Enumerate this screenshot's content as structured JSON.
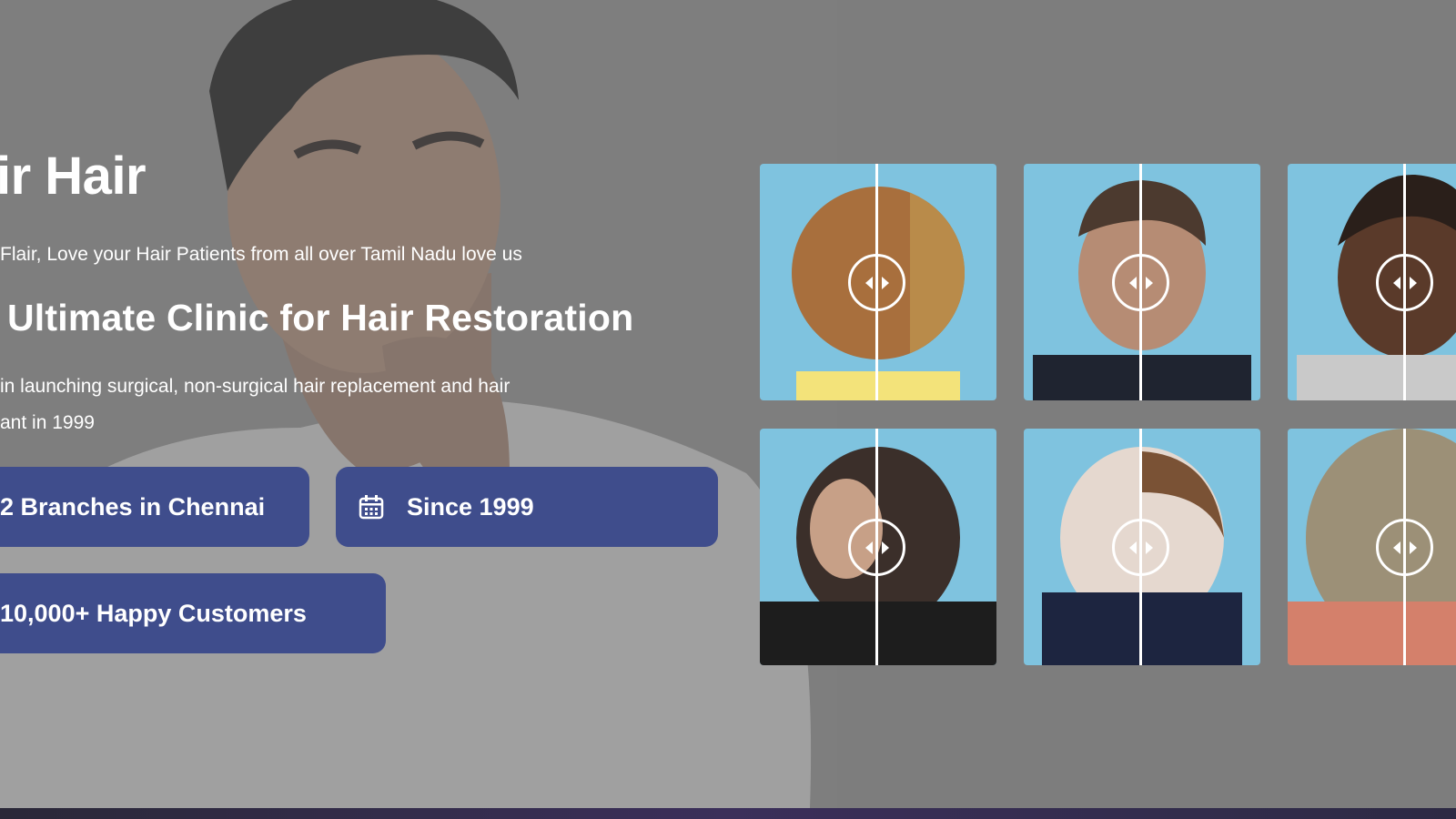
{
  "hero": {
    "brand_partial": "ir Hair",
    "tagline_partial": "Flair, Love your Hair Patients from all over Tamil Nadu love us",
    "headline_partial": "Ultimate Clinic for Hair Restoration",
    "description_line1_partial": "in launching surgical, non-surgical hair replacement and hair",
    "description_line2_partial": "ant in 1999"
  },
  "stats": {
    "branches": "2 Branches in Chennai",
    "since": "Since 1999",
    "customers": "10,000+ Happy Customers"
  },
  "gallery": {
    "tiles": [
      {
        "icon": "before-after-slider-handle-icon"
      },
      {
        "icon": "before-after-slider-handle-icon"
      },
      {
        "icon": "before-after-slider-handle-icon"
      },
      {
        "icon": "before-after-slider-handle-icon"
      },
      {
        "icon": "before-after-slider-handle-icon"
      },
      {
        "icon": "before-after-slider-handle-icon"
      }
    ]
  },
  "colors": {
    "overlay": "#808080",
    "button_bg": "#3f4d8c",
    "text": "#ffffff",
    "tile_bg": "#7fc3df"
  }
}
